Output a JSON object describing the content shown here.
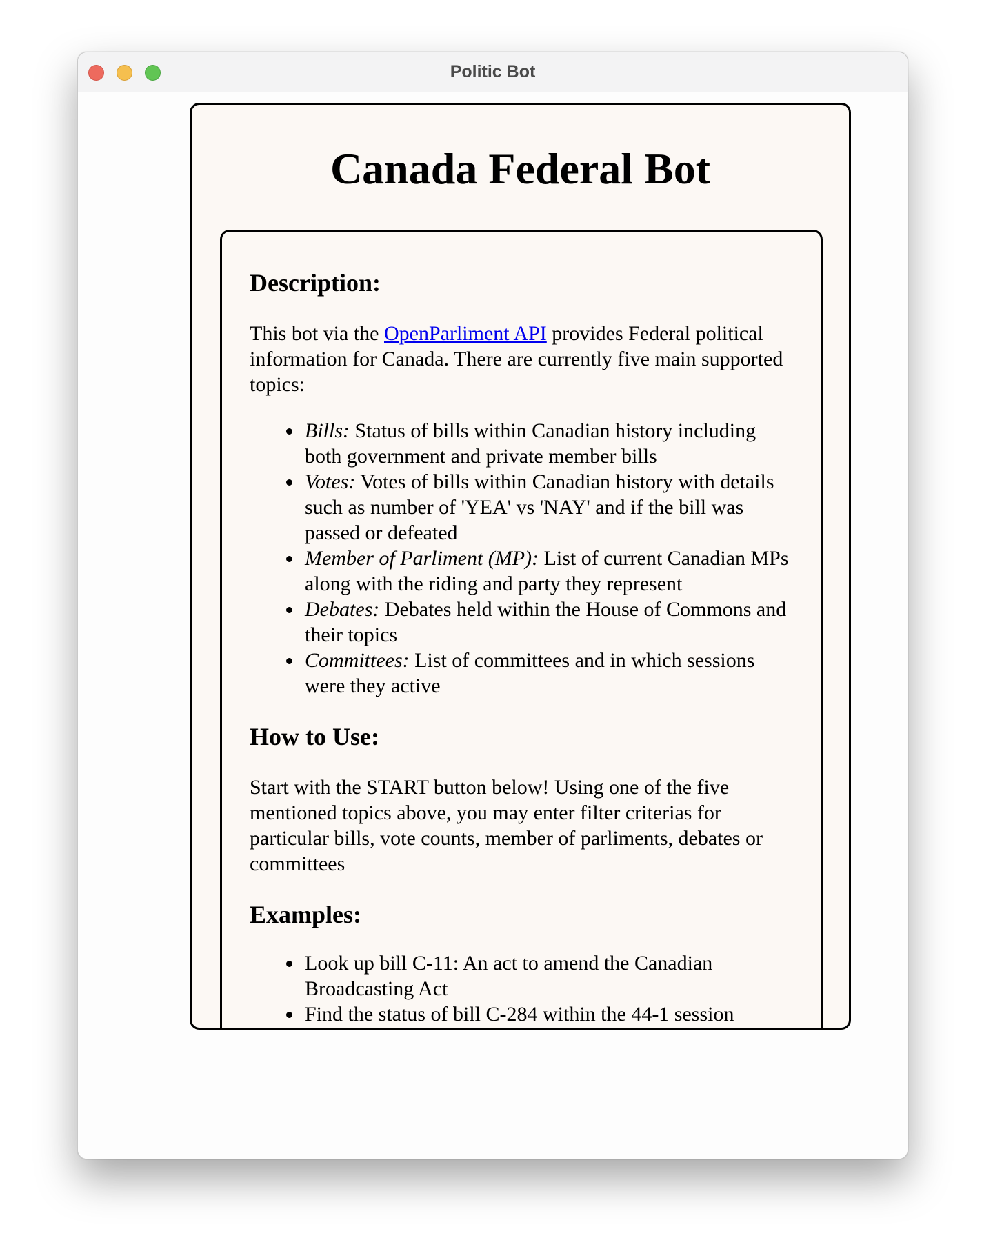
{
  "window": {
    "title": "Politic Bot"
  },
  "page": {
    "title": "Canada Federal Bot",
    "description": {
      "heading": "Description:",
      "intro_prefix": "This bot via the ",
      "link_text": "OpenParliment API",
      "intro_suffix": " provides Federal political information for Canada. There are currently five main supported topics:",
      "topics": [
        {
          "name": "Bills:",
          "text": " Status of bills within Canadian history including both government and private member bills"
        },
        {
          "name": "Votes:",
          "text": " Votes of bills within Canadian history with details such as number of 'YEA' vs 'NAY' and if the bill was passed or defeated"
        },
        {
          "name": "Member of Parliment (MP):",
          "text": " List of current Canadian MPs along with the riding and party they represent"
        },
        {
          "name": "Debates:",
          "text": " Debates held within the House of Commons and their topics"
        },
        {
          "name": "Committees:",
          "text": " List of committees and in which sessions were they active"
        }
      ]
    },
    "how_to_use": {
      "heading": "How to Use:",
      "text": "Start with the START button below! Using one of the five mentioned topics above, you may enter filter criterias for particular bills, vote counts, member of parliments, debates or committees"
    },
    "examples": {
      "heading": "Examples:",
      "items": [
        "Look up bill C-11: An act to amend the Canadian Broadcasting Act",
        "Find the status of bill C-284 within the 44-1 session"
      ]
    }
  }
}
